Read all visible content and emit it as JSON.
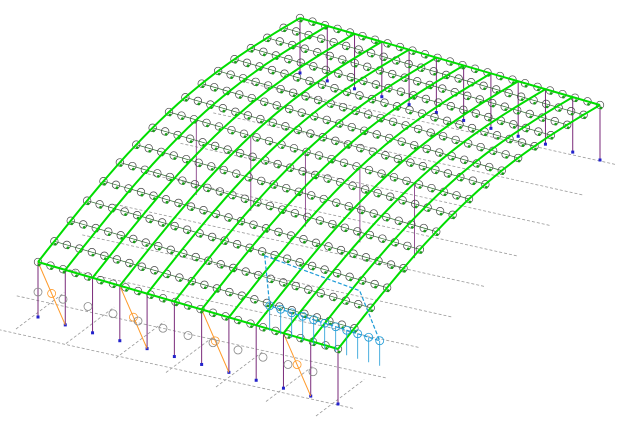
{
  "model": {
    "colors": {
      "background": "#ffffff",
      "frame": "#00dd00",
      "node": "#1aa01a",
      "purlin_ring": "#444444",
      "column": "#7a2a7a",
      "brace": "#ff9a2a",
      "wing_edge": "#1e9bd7",
      "support": "#2222cc",
      "ground": "#9a9a9a",
      "wall_ring": "#888888"
    }
  }
}
